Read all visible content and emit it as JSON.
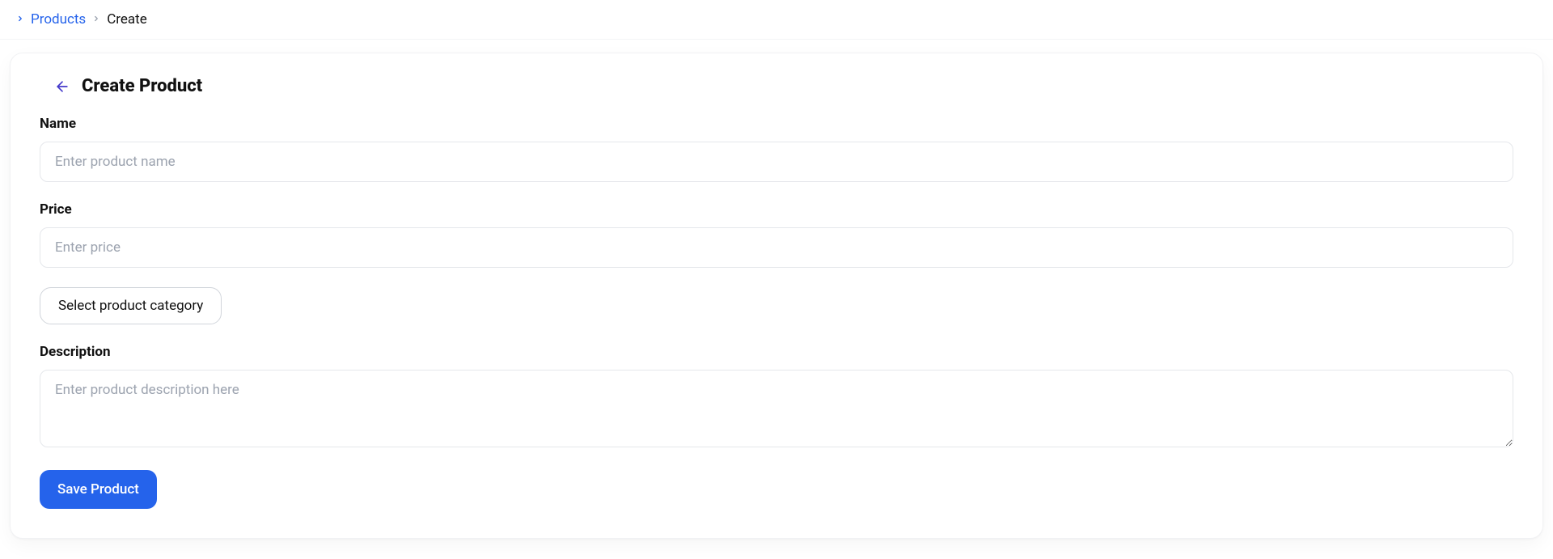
{
  "breadcrumb": {
    "items": [
      {
        "label": "Products",
        "link": true
      },
      {
        "label": "Create",
        "link": false
      }
    ]
  },
  "page": {
    "title": "Create Product"
  },
  "form": {
    "name": {
      "label": "Name",
      "placeholder": "Enter product name",
      "value": ""
    },
    "price": {
      "label": "Price",
      "placeholder": "Enter price",
      "value": ""
    },
    "category_button": "Select product category",
    "description": {
      "label": "Description",
      "placeholder": "Enter product description here",
      "value": ""
    },
    "save_button": "Save Product"
  },
  "colors": {
    "accent": "#2563eb",
    "border": "#e5e7eb",
    "text": "#111111",
    "placeholder": "#9ca3af"
  }
}
